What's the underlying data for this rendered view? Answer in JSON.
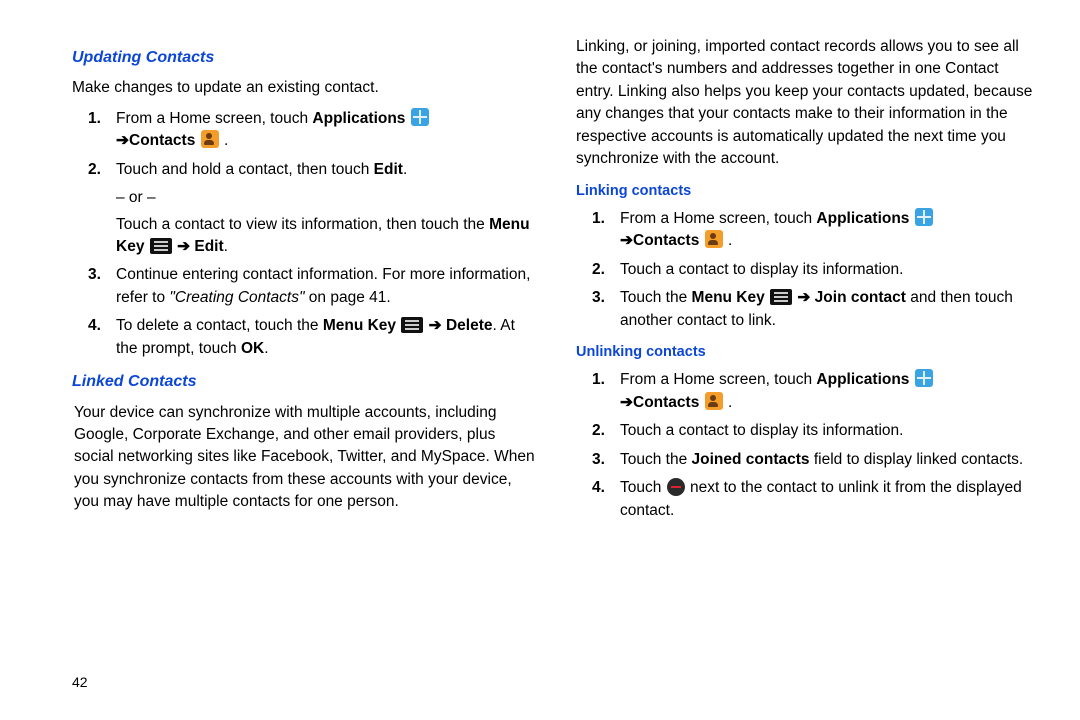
{
  "pageNumber": "42",
  "left": {
    "sec1": {
      "title": "Updating Contacts",
      "intro": "Make changes to update an existing contact.",
      "step1_a": "From a Home screen, touch ",
      "step1_b": "Applications",
      "step1_c": "Contacts",
      "step2_a": "Touch and hold a contact, then touch ",
      "step2_b": "Edit",
      "step2_or": "– or –",
      "step2_c": "Touch a contact to view its information, then touch the ",
      "step2_d": "Menu Key",
      "step2_e": "Edit",
      "step3_a": "Continue entering contact information. For more information, refer to ",
      "step3_ref": "\"Creating Contacts\"",
      "step3_b": " on page 41.",
      "step4_a": "To delete a contact, touch the ",
      "step4_b": "Menu Key",
      "step4_c": "Delete",
      "step4_d": ". At the prompt, touch ",
      "step4_e": "OK"
    },
    "sec2": {
      "title": "Linked Contacts",
      "para": "Your device can synchronize with multiple accounts, including Google, Corporate Exchange, and other email providers, plus social networking sites like Facebook, Twitter, and MySpace. When you synchronize contacts from these accounts with your device, you may have multiple contacts for one person."
    }
  },
  "right": {
    "intro": "Linking, or joining, imported contact records allows you to see all the contact's numbers and addresses together in one Contact entry. Linking also helps you keep your contacts updated, because any changes that your contacts make to their information in the respective accounts is automatically updated the next time you synchronize with the account.",
    "sub1": {
      "title": "Linking contacts",
      "step1_a": "From a Home screen, touch ",
      "step1_b": "Applications",
      "step1_c": "Contacts",
      "step2": "Touch a contact to display its information.",
      "step3_a": "Touch the ",
      "step3_b": "Menu Key",
      "step3_c": "Join contact",
      "step3_d": " and then touch another contact to link."
    },
    "sub2": {
      "title": "Unlinking contacts",
      "step1_a": "From a Home screen, touch ",
      "step1_b": "Applications",
      "step1_c": "Contacts",
      "step2": "Touch a contact to display its information.",
      "step3_a": "Touch the ",
      "step3_b": "Joined contacts",
      "step3_c": " field to display linked contacts.",
      "step4_a": "Touch ",
      "step4_b": " next to the contact to unlink it from the displayed contact."
    }
  },
  "arrow": " ➔ ",
  "arrowPre": "➔"
}
